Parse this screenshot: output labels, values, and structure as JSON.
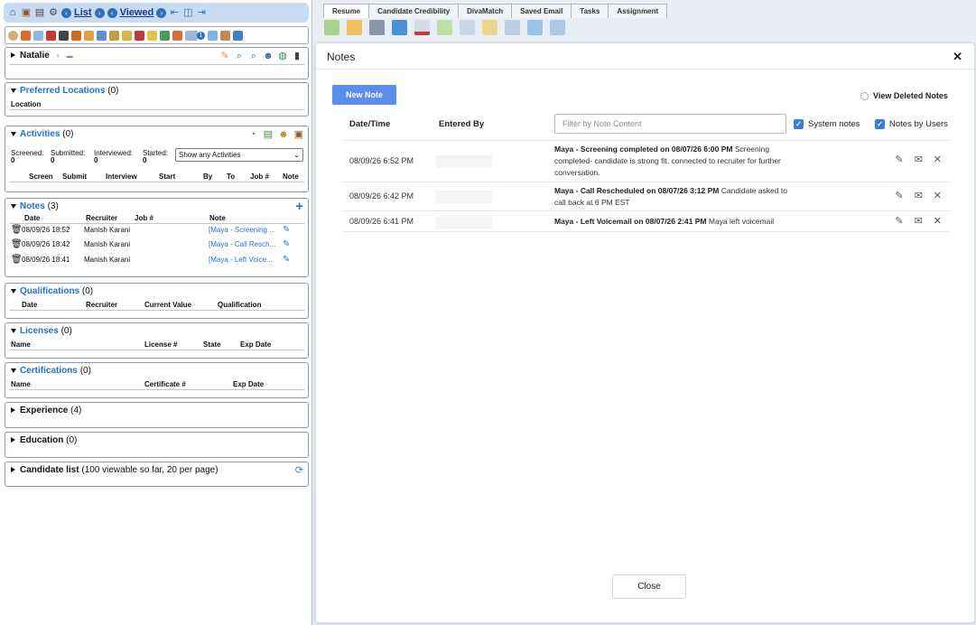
{
  "topbar": {
    "list_label": "List",
    "viewed_label": "Viewed"
  },
  "candidate": {
    "name": "Natalie"
  },
  "preferred_locations": {
    "title": "Preferred Locations",
    "count": "(0)",
    "col_location": "Location"
  },
  "activities": {
    "title": "Activities",
    "count": "(0)",
    "screened_label": "Screened:",
    "screened_value": "0",
    "submitted_label": "Submitted:",
    "submitted_value": "0",
    "interviewed_label": "Interviewed:",
    "interviewed_value": "0",
    "started_label": "Started:",
    "started_value": "0",
    "filter_selected": "Show any Activities",
    "columns": [
      "Screen",
      "Submit",
      "Interview",
      "Start",
      "By",
      "To",
      "Job #",
      "Note"
    ]
  },
  "notes": {
    "title": "Notes",
    "count": "(3)",
    "columns": [
      "Date",
      "Recruiter",
      "Job #",
      "Note"
    ],
    "rows": [
      {
        "date": "08/09/26 18:52",
        "recruiter": "Manish Karani",
        "note": "[Maya - Screening ..."
      },
      {
        "date": "08/09/26 18:42",
        "recruiter": "Manish Karani",
        "note": "[Maya - Call Resch..."
      },
      {
        "date": "08/09/26 18:41",
        "recruiter": "Manish Karani",
        "note": "[Maya - Left Voice..."
      }
    ]
  },
  "qualifications": {
    "title": "Qualifications",
    "count": "(0)",
    "columns": [
      "Date",
      "Recruiter",
      "Current Value",
      "Qualification"
    ]
  },
  "licenses": {
    "title": "Licenses",
    "count": "(0)",
    "columns": [
      "Name",
      "License #",
      "State",
      "Exp Date"
    ]
  },
  "certifications": {
    "title": "Certifications",
    "count": "(0)",
    "columns": [
      "Name",
      "Certificate #",
      "Exp Date"
    ]
  },
  "experience": {
    "title": "Experience",
    "count": "(4)"
  },
  "education": {
    "title": "Education",
    "count": "(0)"
  },
  "candidate_list": {
    "title": "Candidate list",
    "subtitle": "(100 viewable so far, 20 per page)"
  },
  "tabs": [
    "Resume",
    "Candidate Credibility",
    "DivaMatch",
    "Saved Email",
    "Tasks",
    "Assignment"
  ],
  "modal": {
    "title": "Notes",
    "new_note_label": "New Note",
    "view_deleted_label": "View Deleted Notes",
    "col_datetime": "Date/Time",
    "col_entered_by": "Entered By",
    "filter_placeholder": "Filter by Note Content",
    "system_notes_label": "System notes",
    "notes_by_users_label": "Notes by Users",
    "close_label": "Close",
    "rows": [
      {
        "datetime": "08/09/26 6:52 PM",
        "title": "Maya - Screening completed on 08/07/26 6:00 PM",
        "body": " Screening completed- candidate is strong fit, connected to recruiter for further conversation."
      },
      {
        "datetime": "08/09/26 6:42 PM",
        "title": "Maya - Call Rescheduled on 08/07/26 3:12 PM",
        "body": " Candidate asked to call back at 6 PM EST"
      },
      {
        "datetime": "08/09/26 6:41 PM",
        "title": "Maya - Left Voicemail on 08/07/26 2:41 PM",
        "body": " Maya left voicemail"
      }
    ]
  },
  "colors": {
    "accent": "#5b8def",
    "link": "#1e73c8",
    "checkbox": "#3b7ddd"
  }
}
